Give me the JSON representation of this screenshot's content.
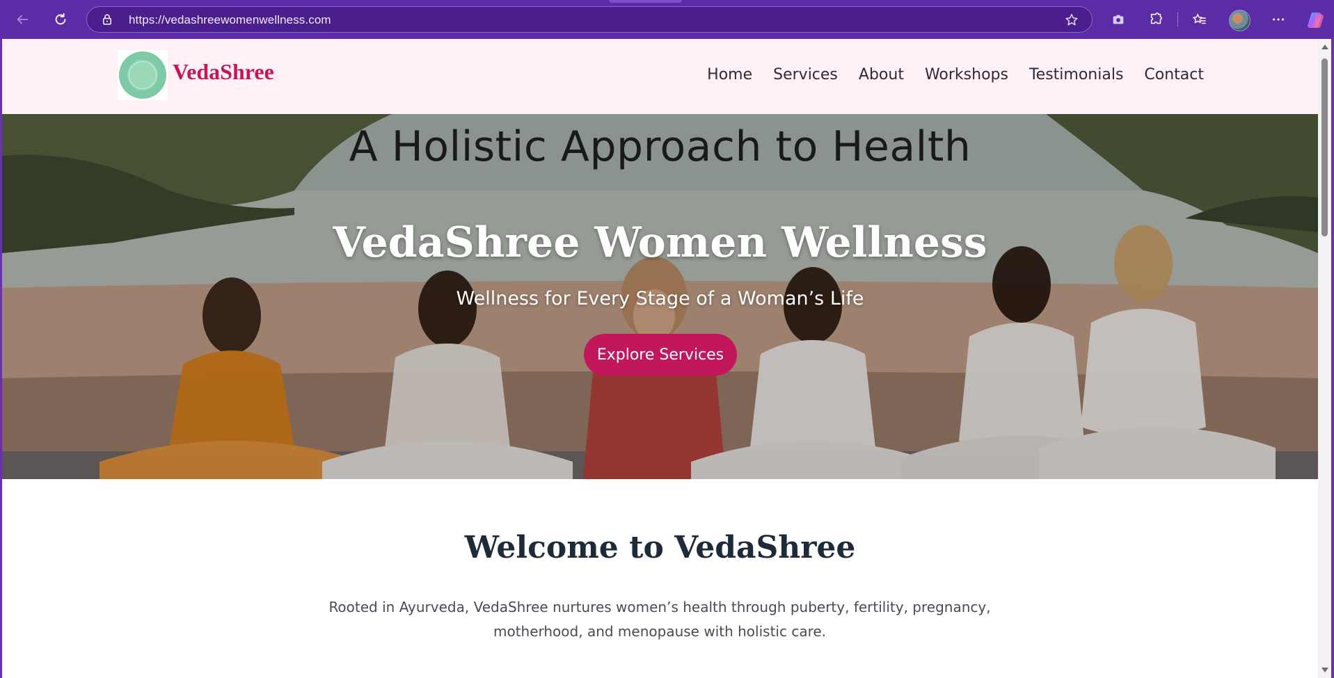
{
  "browser": {
    "url": "https://vedashreewomenwellness.com",
    "icons": [
      "back-arrow-icon",
      "refresh-icon",
      "lock-icon",
      "favorite-star-icon",
      "screenshot-icon",
      "extensions-icon",
      "favorites-icon",
      "profile-avatar",
      "more-options-icon",
      "copilot-icon"
    ]
  },
  "header": {
    "brand": "VedaShree",
    "nav": [
      {
        "label": "Home"
      },
      {
        "label": "Services"
      },
      {
        "label": "About"
      },
      {
        "label": "Workshops"
      },
      {
        "label": "Testimonials"
      },
      {
        "label": "Contact"
      }
    ]
  },
  "hero": {
    "image_caption": "A Holistic Approach to Health",
    "title": "VedaShree Women Wellness",
    "subtitle": "Wellness for Every Stage of a Woman’s Life",
    "cta_label": "Explore Services"
  },
  "welcome": {
    "title": "Welcome to VedaShree",
    "text": "Rooted in Ayurveda, VedaShree nurtures women’s health through puberty, fertility, pregnancy, motherhood, and menopause with holistic care."
  },
  "colors": {
    "browser_frame": "#5c2ca6",
    "brand_accent": "#c2185b",
    "header_bg": "#fff1f5",
    "heading_dark": "#1e2a3a"
  }
}
